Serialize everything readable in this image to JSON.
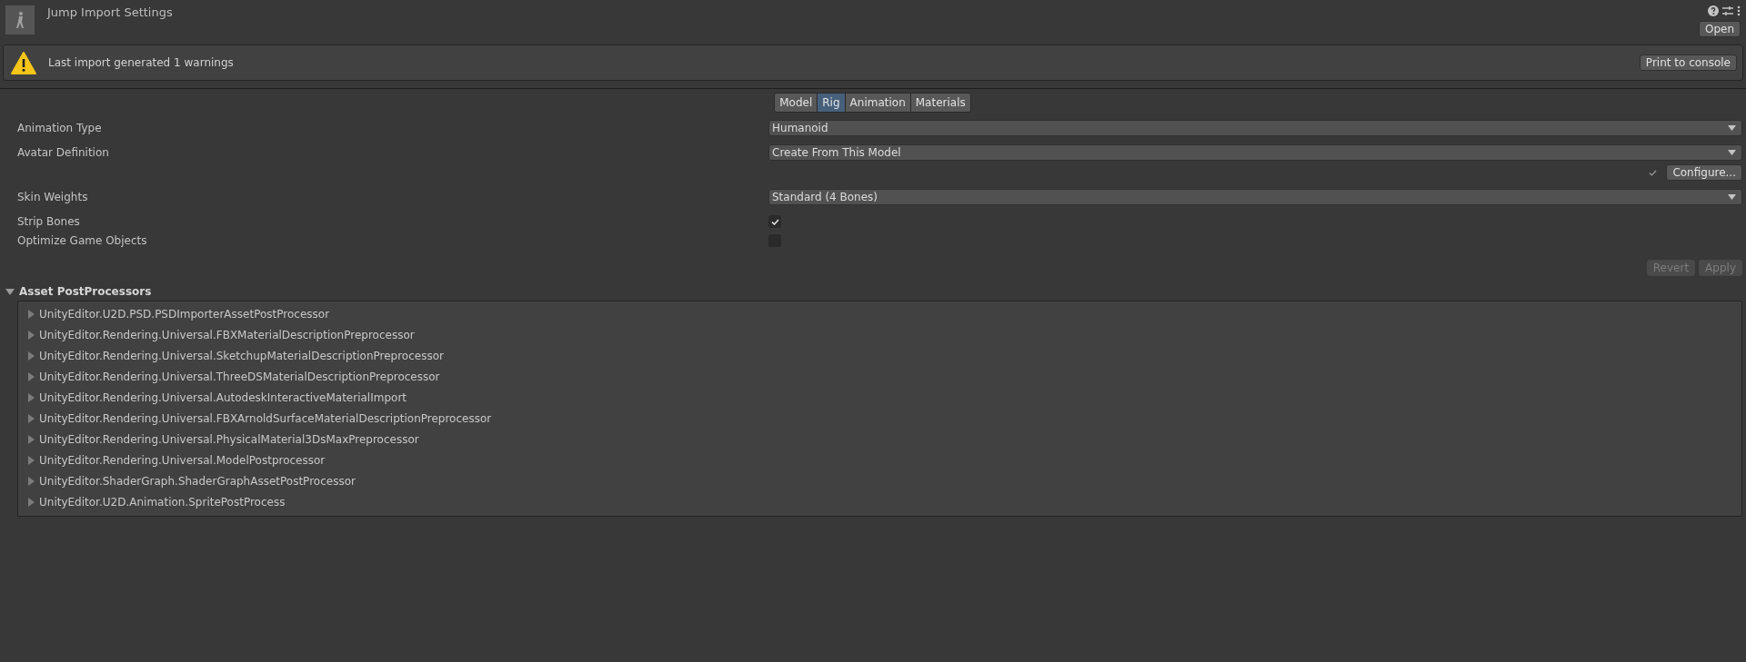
{
  "header": {
    "title": "Jump Import Settings",
    "open_button": "Open"
  },
  "warning": {
    "message": "Last import generated 1 warnings",
    "button": "Print to console"
  },
  "tabs": [
    {
      "label": "Model",
      "selected": false
    },
    {
      "label": "Rig",
      "selected": true
    },
    {
      "label": "Animation",
      "selected": false
    },
    {
      "label": "Materials",
      "selected": false
    }
  ],
  "fields": [
    {
      "kind": "dropdown",
      "label": "Animation Type",
      "value": "Humanoid"
    },
    {
      "kind": "dropdown",
      "label": "Avatar Definition",
      "value": "Create From This Model",
      "button": "Configure..."
    },
    {
      "kind": "dropdown",
      "label": "Skin Weights",
      "value": "Standard (4 Bones)"
    },
    {
      "kind": "checkbox",
      "label": "Strip Bones",
      "checked": true
    },
    {
      "kind": "checkbox",
      "label": "Optimize Game Objects",
      "checked": false
    }
  ],
  "actions": [
    {
      "label": "Revert",
      "disabled": true
    },
    {
      "label": "Apply",
      "disabled": true
    }
  ],
  "post_processors": {
    "title": "Asset PostProcessors",
    "expanded": true,
    "items": [
      {
        "label": "UnityEditor.U2D.PSD.PSDImporterAssetPostProcessor",
        "expanded": false
      },
      {
        "label": "UnityEditor.Rendering.Universal.FBXMaterialDescriptionPreprocessor",
        "expanded": false
      },
      {
        "label": "UnityEditor.Rendering.Universal.SketchupMaterialDescriptionPreprocessor",
        "expanded": false
      },
      {
        "label": "UnityEditor.Rendering.Universal.ThreeDSMaterialDescriptionPreprocessor",
        "expanded": false
      },
      {
        "label": "UnityEditor.Rendering.Universal.AutodeskInteractiveMaterialImport",
        "expanded": false
      },
      {
        "label": "UnityEditor.Rendering.Universal.FBXArnoldSurfaceMaterialDescriptionPreprocessor",
        "expanded": false
      },
      {
        "label": "UnityEditor.Rendering.Universal.PhysicalMaterial3DsMaxPreprocessor",
        "expanded": false
      },
      {
        "label": "UnityEditor.Rendering.Universal.ModelPostprocessor",
        "expanded": false
      },
      {
        "label": "UnityEditor.ShaderGraph.ShaderGraphAssetPostProcessor",
        "expanded": false
      },
      {
        "label": "UnityEditor.U2D.Animation.SpritePostProcess",
        "expanded": false
      }
    ]
  }
}
